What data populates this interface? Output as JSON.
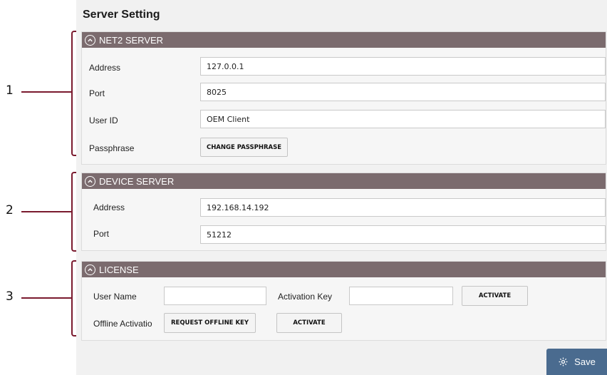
{
  "page_title": "Server Setting",
  "callouts": [
    "1",
    "2",
    "3"
  ],
  "net2_server": {
    "header": "NET2 SERVER",
    "address_label": "Address",
    "address_value": "127.0.0.1",
    "port_label": "Port",
    "port_value": "8025",
    "user_id_label": "User ID",
    "user_id_value": "OEM Client",
    "passphrase_label": "Passphrase",
    "change_passphrase_button": "CHANGE PASSPHRASE"
  },
  "device_server": {
    "header": "DEVICE SERVER",
    "address_label": "Address",
    "address_value": "192.168.14.192",
    "port_label": "Port",
    "port_value": "51212"
  },
  "license": {
    "header": "LICENSE",
    "user_name_label": "User Name",
    "user_name_value": "",
    "activation_key_label": "Activation Key",
    "activation_key_value": "",
    "activate_button": "ACTIVATE",
    "offline_activation_label": "Offline Activatio",
    "request_offline_key_button": "REQUEST OFFLINE KEY",
    "offline_activate_button": "ACTIVATE"
  },
  "save_button": "Save",
  "colors": {
    "section_header": "#7b6b6e",
    "callout": "#7a1a2e",
    "save_button": "#4a6b8f"
  },
  "icons": {
    "collapse": "chevron-up-circle-icon",
    "save": "gear-icon"
  }
}
